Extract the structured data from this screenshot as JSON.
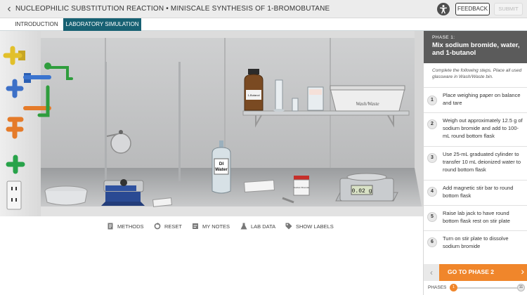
{
  "header": {
    "title": "NUCLEOPHILIC SUBSTITUTION REACTION • MINISCALE SYNTHESIS OF 1-BROMOBUTANE",
    "feedback_label": "FEEDBACK",
    "submit_label": "SUBMIT"
  },
  "tabs": [
    {
      "label": "INTRODUCTION",
      "active": false
    },
    {
      "label": "LABORATORY SIMULATION",
      "active": true
    }
  ],
  "scene": {
    "labels": {
      "butanol_bottle": "1-Butanol",
      "water_bottle_line1": "DI",
      "water_bottle_line2": "Water",
      "sodium_bromide_jar": "Sodium Bromide",
      "wash_bin": "Wash/Waste",
      "balance_display": "0.02 g"
    }
  },
  "toolbar": {
    "methods": "METHODS",
    "reset": "RESET",
    "my_notes": "MY NOTES",
    "lab_data": "LAB DATA",
    "show_labels": "SHOW LABELS"
  },
  "panel": {
    "phase_label": "PHASE 1:",
    "phase_name": "Mix sodium bromide, water, and 1-butanol",
    "instructions": "Complete the following steps. Place all used glassware in Wash/Waste bin.",
    "steps": [
      {
        "num": "1",
        "text": "Place weighing paper on balance and tare"
      },
      {
        "num": "2",
        "text": "Weigh out approximately 12.5 g of sodium bromide and add to 100-mL round bottom flask"
      },
      {
        "num": "3",
        "text": "Use 25-mL graduated cylinder to transfer 10 mL deionized water to round bottom flask"
      },
      {
        "num": "4",
        "text": "Add magnetic stir bar to round bottom flask"
      },
      {
        "num": "5",
        "text": "Raise lab jack to have round bottom flask rest on stir plate"
      },
      {
        "num": "6",
        "text": "Turn on stir plate to dissolve sodium bromide"
      }
    ],
    "go_label": "GO TO PHASE 2",
    "phases_label": "PHASES",
    "phase_current": "1",
    "phase_total": "11"
  },
  "colors": {
    "accent_teal": "#176173",
    "accent_orange": "#f0862b",
    "phase_header": "#5b5b5b"
  }
}
